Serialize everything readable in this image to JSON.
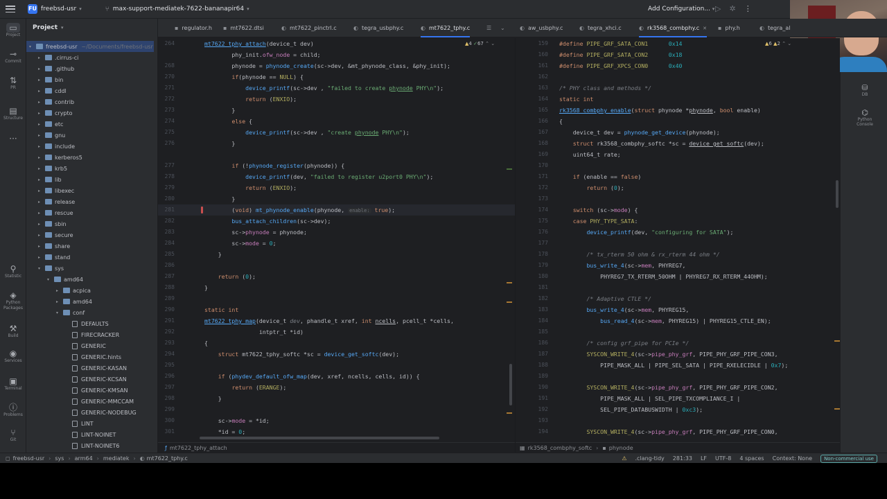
{
  "titlebar": {
    "project_badge": "FU",
    "project_name": "freebsd-usr",
    "branch": "max-support-mediatek-7622-bananapir64",
    "run_config": "Add Configuration..."
  },
  "left_toolbar": [
    {
      "icon": "folder-icon",
      "label": "Project"
    },
    {
      "icon": "commit-icon",
      "label": "Commit"
    },
    {
      "icon": "pull-request-icon",
      "label": "PR"
    },
    {
      "icon": "structure-icon",
      "label": "Structure"
    },
    {
      "icon": "more-icon",
      "label": ""
    },
    {
      "icon": "statistic-icon",
      "label": "Statistic"
    },
    {
      "icon": "python-packages-icon",
      "label": "Python Packages"
    },
    {
      "icon": "build-icon",
      "label": "Build"
    },
    {
      "icon": "services-icon",
      "label": "Services"
    },
    {
      "icon": "terminal-icon",
      "label": "Terminal"
    },
    {
      "icon": "problems-icon",
      "label": "Problems"
    },
    {
      "icon": "git-icon",
      "label": "Git"
    }
  ],
  "right_toolbar": [
    {
      "icon": "database-icon",
      "label": "DB"
    },
    {
      "icon": "python-console-icon",
      "label": "Python Console"
    }
  ],
  "project_panel": {
    "title": "Project",
    "tree": [
      {
        "label": "freebsd-usr",
        "path": "~/Documents/freebsd-usr",
        "depth": 0,
        "type": "folder",
        "expanded": true
      },
      {
        "label": ".cirrus-ci",
        "depth": 1,
        "type": "folder"
      },
      {
        "label": ".github",
        "depth": 1,
        "type": "folder"
      },
      {
        "label": "bin",
        "depth": 1,
        "type": "folder"
      },
      {
        "label": "cddl",
        "depth": 1,
        "type": "folder"
      },
      {
        "label": "contrib",
        "depth": 1,
        "type": "folder"
      },
      {
        "label": "crypto",
        "depth": 1,
        "type": "folder"
      },
      {
        "label": "etc",
        "depth": 1,
        "type": "folder"
      },
      {
        "label": "gnu",
        "depth": 1,
        "type": "folder"
      },
      {
        "label": "include",
        "depth": 1,
        "type": "folder"
      },
      {
        "label": "kerberos5",
        "depth": 1,
        "type": "folder"
      },
      {
        "label": "krb5",
        "depth": 1,
        "type": "folder"
      },
      {
        "label": "lib",
        "depth": 1,
        "type": "folder"
      },
      {
        "label": "libexec",
        "depth": 1,
        "type": "folder"
      },
      {
        "label": "release",
        "depth": 1,
        "type": "folder"
      },
      {
        "label": "rescue",
        "depth": 1,
        "type": "folder"
      },
      {
        "label": "sbin",
        "depth": 1,
        "type": "folder"
      },
      {
        "label": "secure",
        "depth": 1,
        "type": "folder"
      },
      {
        "label": "share",
        "depth": 1,
        "type": "folder"
      },
      {
        "label": "stand",
        "depth": 1,
        "type": "folder"
      },
      {
        "label": "sys",
        "depth": 1,
        "type": "folder",
        "expanded": true
      },
      {
        "label": "amd64",
        "depth": 2,
        "type": "folder",
        "expanded": true
      },
      {
        "label": "acpica",
        "depth": 3,
        "type": "folder"
      },
      {
        "label": "amd64",
        "depth": 3,
        "type": "folder"
      },
      {
        "label": "conf",
        "depth": 3,
        "type": "folder",
        "expanded": true
      },
      {
        "label": "DEFAULTS",
        "depth": 4,
        "type": "file"
      },
      {
        "label": "FIRECRACKER",
        "depth": 4,
        "type": "file"
      },
      {
        "label": "GENERIC",
        "depth": 4,
        "type": "file"
      },
      {
        "label": "GENERIC.hints",
        "depth": 4,
        "type": "file"
      },
      {
        "label": "GENERIC-KASAN",
        "depth": 4,
        "type": "file"
      },
      {
        "label": "GENERIC-KCSAN",
        "depth": 4,
        "type": "file"
      },
      {
        "label": "GENERIC-KMSAN",
        "depth": 4,
        "type": "file"
      },
      {
        "label": "GENERIC-MMCCAM",
        "depth": 4,
        "type": "file"
      },
      {
        "label": "GENERIC-NODEBUG",
        "depth": 4,
        "type": "file"
      },
      {
        "label": "LINT",
        "depth": 4,
        "type": "file"
      },
      {
        "label": "LINT-NOINET",
        "depth": 4,
        "type": "file"
      },
      {
        "label": "LINT-NOINET6",
        "depth": 4,
        "type": "file"
      }
    ]
  },
  "tabs": [
    {
      "label": "regulator.h",
      "icon": "h-file-icon"
    },
    {
      "label": "mt7622.dtsi",
      "icon": "dts-file-icon"
    },
    {
      "label": "mt7622_pinctrl.c",
      "icon": "c-file-icon"
    },
    {
      "label": "tegra_usbphy.c",
      "icon": "c-file-icon"
    },
    {
      "label": "mt7622_tphy.c",
      "icon": "c-file-icon",
      "active": true
    },
    {
      "label": "aw_usbphy.c",
      "icon": "c-file-icon"
    },
    {
      "label": "tegra_xhci.c",
      "icon": "c-file-icon"
    },
    {
      "label": "rk3568_combphy.c",
      "icon": "c-file-icon",
      "active": true
    },
    {
      "label": "phy.h",
      "icon": "h-file-icon"
    },
    {
      "label": "tegra_al",
      "icon": "c-file-icon"
    }
  ],
  "left_editor": {
    "indicator_warnings": "4",
    "indicator_weak": "67",
    "lines": [
      {
        "n": "264",
        "html": "<span class=\"fn ul\">mt7622_tphy_attach</span>(device_t <span class=\"ty\">dev</span>)"
      },
      {
        "n": "",
        "html": "        phy_init.<span class=\"fd\">ofw_node</span> = child;"
      },
      {
        "n": "268",
        "html": "        phynode = <span class=\"fn\">phynode_create</span>(sc-&gt;dev, &amp;mt_phynode_class, &amp;phy_init);"
      },
      {
        "n": "270",
        "html": "        <span class=\"kw\">if</span>(phynode == <span class=\"mc\">NULL</span>) {"
      },
      {
        "n": "271",
        "html": "            <span class=\"fn\">device_printf</span>(sc-&gt;dev , <span class=\"st\">\"failed to create <span class=\"ul\">phynode</span> PHY\\n\"</span>);"
      },
      {
        "n": "272",
        "html": "            <span class=\"kw\">return</span> (<span class=\"mc\">ENXIO</span>);"
      },
      {
        "n": "273",
        "html": "        }"
      },
      {
        "n": "274",
        "html": "        <span class=\"kw\">else</span> {"
      },
      {
        "n": "275",
        "html": "            <span class=\"fn\">device_printf</span>(sc-&gt;dev , <span class=\"st\">\"create <span class=\"ul\">phynode</span> PHY\\n\"</span>);"
      },
      {
        "n": "276",
        "html": "        }"
      },
      {
        "n": "",
        "html": ""
      },
      {
        "n": "277",
        "html": "        <span class=\"kw\">if</span> (!<span class=\"fn\">phynode_register</span>(phynode)) {"
      },
      {
        "n": "278",
        "html": "            <span class=\"fn\">device_printf</span>(dev, <span class=\"st\">\"failed to register u2port0 PHY\\n\"</span>);"
      },
      {
        "n": "279",
        "html": "            <span class=\"kw\">return</span> (<span class=\"mc\">ENXIO</span>);"
      },
      {
        "n": "280",
        "html": "        }"
      },
      {
        "n": "281",
        "html": "        (<span class=\"kw\">void</span>) <span class=\"fn\">mt_phynode_enable</span>(phynode, <span class=\"hint\">enable:</span> <span class=\"kw\">true</span>);"
      },
      {
        "n": "282",
        "html": "        <span class=\"fn\">bus_attach_children</span>(sc-&gt;dev);"
      },
      {
        "n": "283",
        "html": "        sc-&gt;<span class=\"fd\">phynode</span> = phynode;"
      },
      {
        "n": "284",
        "html": "        sc-&gt;<span class=\"fd\">mode</span> = <span class=\"nu\">0</span>;"
      },
      {
        "n": "285",
        "html": "    }"
      },
      {
        "n": "286",
        "html": ""
      },
      {
        "n": "287",
        "html": "    <span class=\"kw\">return</span> (<span class=\"nu\">0</span>);"
      },
      {
        "n": "288",
        "html": "}"
      },
      {
        "n": "289",
        "html": ""
      },
      {
        "n": "290",
        "html": "<span class=\"kw\">static int</span>"
      },
      {
        "n": "291",
        "html": "<span class=\"fn ul\">mt7622_tphy_map</span>(device_t <span class=\"cm\">dev</span>, phandle_t <span class=\"ty\">xref</span>, <span class=\"kw\">int</span> <span class=\"ul\">ncells</span>, pcell_t *<span class=\"ty\">cells</span>,"
      },
      {
        "n": "292",
        "html": "                intptr_t *<span class=\"ty\">id</span>)"
      },
      {
        "n": "293",
        "html": "{"
      },
      {
        "n": "294",
        "html": "    <span class=\"kw\">struct</span> <span class=\"ty\">mt7622_tphy_softc</span> *sc = <span class=\"fn\">device_get_softc</span>(dev);"
      },
      {
        "n": "295",
        "html": ""
      },
      {
        "n": "296",
        "html": "    <span class=\"kw\">if</span> (<span class=\"fn\">phydev_default_ofw_map</span>(dev, xref, ncells, cells, id)) {"
      },
      {
        "n": "297",
        "html": "        <span class=\"kw\">return</span> (<span class=\"mc\">ERANGE</span>);"
      },
      {
        "n": "298",
        "html": "    }"
      },
      {
        "n": "299",
        "html": ""
      },
      {
        "n": "300",
        "html": "    sc-&gt;<span class=\"fd\">mode</span> = *id;"
      },
      {
        "n": "301",
        "html": "    *id = <span class=\"nu\">0</span>;"
      }
    ]
  },
  "right_editor": {
    "indicator_warnings": "6",
    "indicator_weak": "2",
    "lines": [
      {
        "n": "159",
        "html": "<span class=\"kw\">#define</span> <span class=\"mc\">PIPE_GRF_SATA_CON1</span>      <span class=\"nu\">0x14</span>"
      },
      {
        "n": "160",
        "html": "<span class=\"kw\">#define</span> <span class=\"mc\">PIPE_GRF_SATA_CON2</span>      <span class=\"nu\">0x18</span>"
      },
      {
        "n": "161",
        "html": "<span class=\"kw\">#define</span> <span class=\"mc\">PIPE_GRF_XPCS_CON0</span>      <span class=\"nu\">0x40</span>"
      },
      {
        "n": "162",
        "html": ""
      },
      {
        "n": "163",
        "html": "<span class=\"cm\">/* PHY class and methods */</span>"
      },
      {
        "n": "164",
        "html": "<span class=\"kw\">static int</span>"
      },
      {
        "n": "165",
        "html": "<span class=\"fn ul\">rk3568_combphy_enable</span>(<span class=\"kw\">struct</span> phynode *<span class=\"ul\">phynode</span>, <span class=\"kw\">bool</span> enable)"
      },
      {
        "n": "166",
        "html": "{"
      },
      {
        "n": "167",
        "html": "    device_t dev = <span class=\"fn\">phynode_get_device</span>(phynode);"
      },
      {
        "n": "168",
        "html": "    <span class=\"kw\">struct</span> rk3568_combphy_softc *sc = <span class=\"ul\">device_get_softc</span>(dev);"
      },
      {
        "n": "169",
        "html": "    uint64_t rate;"
      },
      {
        "n": "170",
        "html": ""
      },
      {
        "n": "171",
        "html": "    <span class=\"kw\">if</span> (enable == <span class=\"kw\">false</span>)"
      },
      {
        "n": "172",
        "html": "        <span class=\"kw\">return</span> (<span class=\"nu\">0</span>);"
      },
      {
        "n": "173",
        "html": ""
      },
      {
        "n": "174",
        "html": "    <span class=\"kw\">switch</span> (sc-&gt;<span class=\"fd\">mode</span>) {"
      },
      {
        "n": "175",
        "html": "    <span class=\"kw\">case</span> <span class=\"mc\">PHY_TYPE_SATA</span>:"
      },
      {
        "n": "176",
        "html": "        <span class=\"fn\">device_printf</span>(dev, <span class=\"st\">\"configuring for SATA\"</span>);"
      },
      {
        "n": "177",
        "html": ""
      },
      {
        "n": "178",
        "html": "        <span class=\"cm\">/* tx_rterm 50 ohm &amp; rx_rterm 44 ohm */</span>"
      },
      {
        "n": "179",
        "html": "        <span class=\"fn\">bus_write_4</span>(sc-&gt;<span class=\"fd\">mem</span>, PHYREG7,"
      },
      {
        "n": "180",
        "html": "            PHYREG7_TX_RTERM_50OHM | PHYREG7_RX_RTERM_44OHM);"
      },
      {
        "n": "181",
        "html": ""
      },
      {
        "n": "182",
        "html": "        <span class=\"cm\">/* Adaptive CTLE */</span>"
      },
      {
        "n": "183",
        "html": "        <span class=\"fn\">bus_write_4</span>(sc-&gt;<span class=\"fd\">mem</span>, PHYREG15,"
      },
      {
        "n": "184",
        "html": "            <span class=\"fn\">bus_read_4</span>(sc-&gt;<span class=\"fd\">mem</span>, PHYREG15) | PHYREG15_CTLE_EN);"
      },
      {
        "n": "185",
        "html": ""
      },
      {
        "n": "186",
        "html": "        <span class=\"cm\">/* config grf_pipe for PCIe */</span>"
      },
      {
        "n": "187",
        "html": "        <span class=\"mc\">SYSCON_WRITE_4</span>(sc-&gt;<span class=\"fd\">pipe_phy_grf</span>, PIPE_PHY_GRF_PIPE_CON3,"
      },
      {
        "n": "188",
        "html": "            PIPE_MASK_ALL | PIPE_SEL_SATA | PIPE_RXELECIDLE | <span class=\"nu\">0x7</span>);"
      },
      {
        "n": "189",
        "html": ""
      },
      {
        "n": "190",
        "html": "        <span class=\"mc\">SYSCON_WRITE_4</span>(sc-&gt;<span class=\"fd\">pipe_phy_grf</span>, PIPE_PHY_GRF_PIPE_CON2,"
      },
      {
        "n": "191",
        "html": "            PIPE_MASK_ALL | SEL_PIPE_TXCOMPLIANCE_I |"
      },
      {
        "n": "192",
        "html": "            SEL_PIPE_DATABUSWIDTH | <span class=\"nu\">0xc3</span>);"
      },
      {
        "n": "193",
        "html": ""
      },
      {
        "n": "194",
        "html": "        <span class=\"mc\">SYSCON_WRITE_4</span>(sc-&gt;<span class=\"fd\">pipe_phy_grf</span>, PIPE_PHY_GRF_PIPE_CON0,"
      }
    ]
  },
  "left_breadcrumb": "mt7622_tphy_attach",
  "right_breadcrumb": [
    "rk3568_combphy_softc",
    "phynode"
  ],
  "status": {
    "path": [
      "freebsd-usr",
      "sys",
      "arm64",
      "mediatek",
      "mt7622_tphy.c"
    ],
    "clangd": ".clang-tidy",
    "position": "281:33",
    "line_ending": "LF",
    "encoding": "UTF-8",
    "indent": "4 spaces",
    "context": "Context: None",
    "license": "Non-commercial use"
  }
}
